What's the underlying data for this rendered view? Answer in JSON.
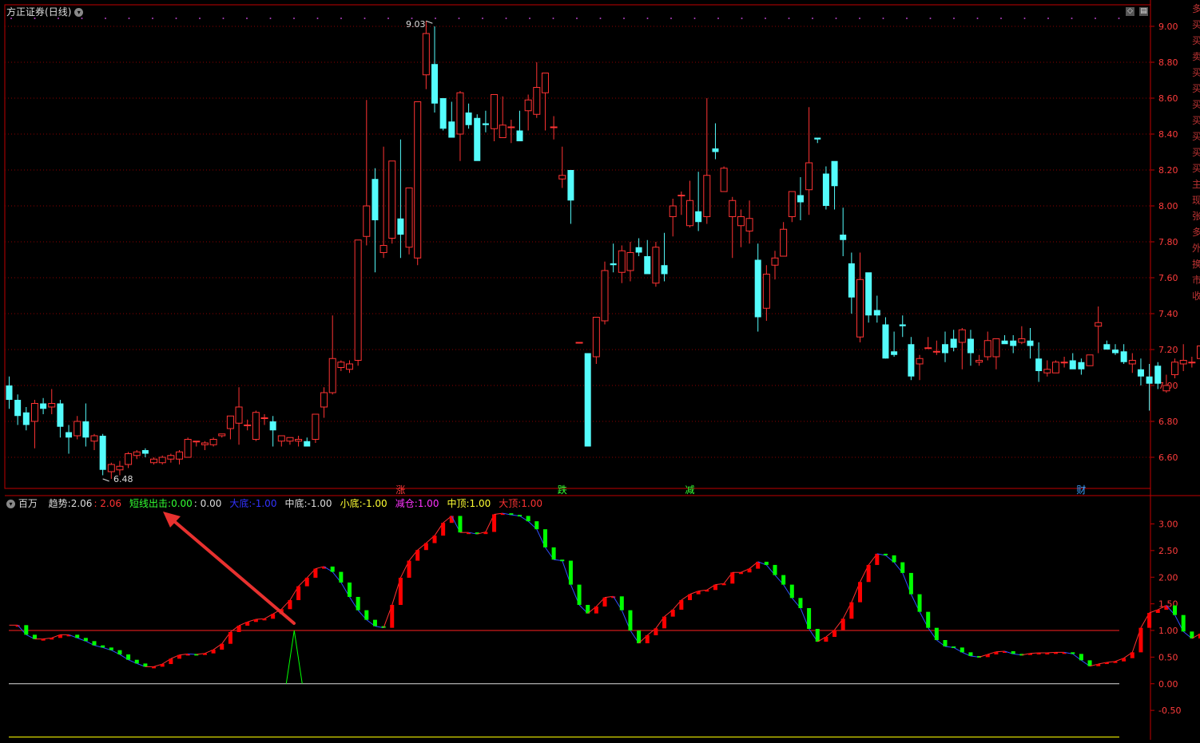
{
  "main_panel": {
    "title": "方正证券",
    "period": "(日线)",
    "high_label": "9.03",
    "low_label": "6.48",
    "event_tags": [
      {
        "text": "涨",
        "color": "#ff3b3b",
        "bar": 46
      },
      {
        "text": "跌",
        "color": "#33ff33",
        "bar": 65
      },
      {
        "text": "减",
        "color": "#33ff33",
        "bar": 80
      },
      {
        "text": "财",
        "color": "#3aa0ff",
        "bar": 126
      }
    ],
    "right_strip": [
      "多",
      "买",
      "买",
      "卖",
      "买",
      "买",
      "买",
      "买",
      "买",
      "买",
      "买",
      "主",
      "现",
      "张",
      "多",
      "外",
      "换",
      "市",
      "收"
    ]
  },
  "indicator_panel": {
    "name": "百万",
    "legend": [
      {
        "label": "趋势:",
        "value": "2.06",
        "color": "#dddddd"
      },
      {
        "label": "",
        "value": ": 2.06",
        "color": "#ff3333"
      },
      {
        "label": "短线出击:",
        "value": "0.00",
        "color": "#33ff33"
      },
      {
        "label": "",
        "value": ": 0.00",
        "color": "#dddddd"
      },
      {
        "label": "大底:",
        "value": "-1.00",
        "color": "#3333ff"
      },
      {
        "label": "中底:",
        "value": "-1.00",
        "color": "#dddddd"
      },
      {
        "label": "小底:",
        "value": "-1.00",
        "color": "#ffff33"
      },
      {
        "label": "减仓:",
        "value": "1.00",
        "color": "#ff33ff"
      },
      {
        "label": "中顶:",
        "value": "1.00",
        "color": "#ffff33"
      },
      {
        "label": "大顶:",
        "value": "1.00",
        "color": "#ff3333"
      }
    ]
  },
  "colors": {
    "up": "#ff3333",
    "down": "#54fcfc",
    "grid": "#8b0000",
    "axis": "#c00000",
    "ind_up": "#ff0000",
    "ind_down": "#00ff00",
    "arrow": "#e8312f"
  },
  "chart_data": [
    {
      "type": "candlestick",
      "title": "方正证券 (日线)",
      "ylim": [
        6.5,
        9.1
      ],
      "y_ticks": [
        "6.60",
        "6.80",
        "7.00",
        "7.20",
        "7.40",
        "7.60",
        "7.80",
        "8.00",
        "8.20",
        "8.40",
        "8.60",
        "8.80",
        "9.00"
      ],
      "ohlc": [
        [
          7.0,
          7.05,
          6.87,
          6.92
        ],
        [
          6.92,
          6.95,
          6.78,
          6.83
        ],
        [
          6.85,
          6.88,
          6.75,
          6.78
        ],
        [
          6.8,
          6.92,
          6.65,
          6.9
        ],
        [
          6.9,
          6.93,
          6.84,
          6.87
        ],
        [
          6.88,
          6.98,
          6.84,
          6.9
        ],
        [
          6.9,
          6.92,
          6.71,
          6.77
        ],
        [
          6.74,
          6.78,
          6.62,
          6.71
        ],
        [
          6.72,
          6.83,
          6.7,
          6.8
        ],
        [
          6.8,
          6.9,
          6.66,
          6.71
        ],
        [
          6.69,
          6.73,
          6.64,
          6.72
        ],
        [
          6.72,
          6.73,
          6.5,
          6.53
        ],
        [
          6.52,
          6.57,
          6.48,
          6.56
        ],
        [
          6.53,
          6.58,
          6.5,
          6.55
        ],
        [
          6.56,
          6.63,
          6.54,
          6.62
        ],
        [
          6.61,
          6.64,
          6.59,
          6.63
        ],
        [
          6.64,
          6.65,
          6.6,
          6.62
        ],
        [
          6.57,
          6.6,
          6.56,
          6.59
        ],
        [
          6.57,
          6.61,
          6.56,
          6.6
        ],
        [
          6.59,
          6.62,
          6.57,
          6.61
        ],
        [
          6.59,
          6.64,
          6.56,
          6.63
        ],
        [
          6.6,
          6.71,
          6.6,
          6.7
        ],
        [
          6.69,
          6.69,
          6.66,
          6.69
        ],
        [
          6.67,
          6.69,
          6.64,
          6.68
        ],
        [
          6.67,
          6.71,
          6.66,
          6.7
        ],
        [
          6.72,
          6.73,
          6.71,
          6.73
        ],
        [
          6.76,
          6.82,
          6.7,
          6.83
        ],
        [
          6.79,
          6.99,
          6.67,
          6.88
        ],
        [
          6.78,
          6.81,
          6.75,
          6.78
        ],
        [
          6.7,
          6.86,
          6.69,
          6.85
        ],
        [
          6.82,
          6.84,
          6.78,
          6.82
        ],
        [
          6.8,
          6.83,
          6.66,
          6.75
        ],
        [
          6.69,
          6.72,
          6.66,
          6.72
        ],
        [
          6.69,
          6.71,
          6.67,
          6.71
        ],
        [
          6.69,
          6.72,
          6.66,
          6.7
        ],
        [
          6.69,
          6.71,
          6.66,
          6.66
        ],
        [
          6.7,
          6.84,
          6.68,
          6.84
        ],
        [
          6.88,
          6.99,
          6.82,
          6.96
        ],
        [
          6.96,
          7.39,
          6.95,
          7.15
        ],
        [
          7.1,
          7.14,
          7.08,
          7.13
        ],
        [
          7.09,
          7.14,
          7.07,
          7.12
        ],
        [
          7.14,
          7.8,
          7.11,
          7.81
        ],
        [
          7.83,
          8.59,
          7.78,
          8.0
        ],
        [
          8.15,
          8.21,
          7.63,
          7.92
        ],
        [
          7.74,
          8.33,
          7.71,
          7.78
        ],
        [
          7.82,
          8.2,
          7.79,
          8.25
        ],
        [
          7.93,
          8.37,
          7.71,
          7.84
        ],
        [
          7.77,
          8.05,
          7.73,
          8.1
        ],
        [
          7.71,
          8.49,
          7.67,
          8.58
        ],
        [
          8.73,
          9.03,
          8.65,
          8.96
        ],
        [
          8.79,
          9.0,
          8.52,
          8.57
        ],
        [
          8.6,
          8.55,
          8.42,
          8.43
        ],
        [
          8.47,
          8.58,
          8.39,
          8.38
        ],
        [
          8.4,
          8.64,
          8.25,
          8.63
        ],
        [
          8.52,
          8.57,
          8.43,
          8.45
        ],
        [
          8.49,
          8.51,
          8.27,
          8.25
        ],
        [
          8.46,
          8.53,
          8.41,
          8.45
        ],
        [
          8.43,
          8.61,
          8.36,
          8.62
        ],
        [
          8.38,
          8.61,
          8.38,
          8.45
        ],
        [
          8.44,
          8.48,
          8.35,
          8.44
        ],
        [
          8.42,
          8.53,
          8.37,
          8.36
        ],
        [
          8.53,
          8.62,
          8.42,
          8.59
        ],
        [
          8.51,
          8.8,
          8.49,
          8.66
        ],
        [
          8.63,
          8.71,
          8.42,
          8.74
        ],
        [
          8.44,
          8.5,
          8.37,
          8.44
        ],
        [
          8.15,
          8.33,
          8.1,
          8.17
        ],
        [
          8.2,
          8.2,
          7.9,
          8.03
        ],
        [
          7.24,
          7.24,
          7.24,
          7.24
        ],
        [
          7.18,
          7.16,
          6.66,
          6.66
        ],
        [
          7.16,
          7.34,
          7.12,
          7.38
        ],
        [
          7.36,
          7.69,
          7.34,
          7.64
        ],
        [
          7.68,
          7.79,
          7.63,
          7.67
        ],
        [
          7.63,
          7.78,
          7.57,
          7.75
        ],
        [
          7.64,
          7.8,
          7.58,
          7.74
        ],
        [
          7.77,
          7.82,
          7.72,
          7.74
        ],
        [
          7.72,
          7.81,
          7.62,
          7.62
        ],
        [
          7.57,
          7.8,
          7.55,
          7.77
        ],
        [
          7.67,
          7.85,
          7.58,
          7.62
        ],
        [
          7.94,
          8.04,
          7.83,
          8.0
        ],
        [
          8.06,
          8.08,
          7.95,
          8.06
        ],
        [
          7.89,
          8.14,
          7.88,
          8.03
        ],
        [
          7.97,
          8.19,
          7.86,
          7.91
        ],
        [
          7.94,
          8.6,
          7.9,
          8.17
        ],
        [
          8.32,
          8.46,
          8.26,
          8.3
        ],
        [
          8.08,
          8.22,
          8.08,
          8.21
        ],
        [
          7.94,
          8.05,
          7.71,
          8.03
        ],
        [
          7.89,
          7.98,
          7.77,
          7.94
        ],
        [
          7.86,
          8.03,
          7.79,
          7.93
        ],
        [
          7.7,
          7.79,
          7.3,
          7.38
        ],
        [
          7.43,
          7.67,
          7.36,
          7.62
        ],
        [
          7.67,
          7.75,
          7.59,
          7.71
        ],
        [
          7.72,
          7.91,
          7.75,
          7.87
        ],
        [
          7.94,
          8.07,
          7.91,
          8.08
        ],
        [
          8.06,
          8.16,
          7.92,
          8.02
        ],
        [
          8.09,
          8.55,
          7.95,
          8.24
        ],
        [
          8.38,
          8.38,
          8.35,
          8.37
        ],
        [
          8.18,
          8.22,
          7.98,
          8.0
        ],
        [
          8.25,
          8.19,
          7.98,
          8.11
        ],
        [
          7.84,
          7.99,
          7.72,
          7.81
        ],
        [
          7.68,
          7.74,
          7.4,
          7.49
        ],
        [
          7.27,
          7.74,
          7.24,
          7.59
        ],
        [
          7.63,
          7.59,
          7.35,
          7.39
        ],
        [
          7.42,
          7.5,
          7.35,
          7.39
        ],
        [
          7.34,
          7.38,
          7.15,
          7.15
        ],
        [
          7.19,
          7.3,
          7.16,
          7.17
        ],
        [
          7.34,
          7.39,
          7.27,
          7.33
        ],
        [
          7.23,
          7.27,
          7.03,
          7.05
        ],
        [
          7.12,
          7.17,
          7.03,
          7.15
        ],
        [
          7.21,
          7.27,
          7.21,
          7.21
        ],
        [
          7.19,
          7.25,
          7.17,
          7.19
        ],
        [
          7.23,
          7.3,
          7.13,
          7.18
        ],
        [
          7.26,
          7.31,
          7.19,
          7.21
        ],
        [
          7.24,
          7.32,
          7.09,
          7.31
        ],
        [
          7.26,
          7.31,
          7.11,
          7.18
        ],
        [
          7.13,
          7.17,
          7.11,
          7.14
        ],
        [
          7.16,
          7.3,
          7.14,
          7.25
        ],
        [
          7.16,
          7.26,
          7.09,
          7.26
        ],
        [
          7.25,
          7.28,
          7.24,
          7.23
        ],
        [
          7.25,
          7.28,
          7.18,
          7.22
        ],
        [
          7.24,
          7.33,
          7.23,
          7.26
        ],
        [
          7.25,
          7.32,
          7.15,
          7.22
        ],
        [
          7.15,
          7.24,
          7.02,
          7.08
        ],
        [
          7.07,
          7.14,
          7.05,
          7.09
        ],
        [
          7.07,
          7.14,
          7.07,
          7.13
        ],
        [
          7.13,
          7.16,
          7.1,
          7.13
        ],
        [
          7.14,
          7.18,
          7.1,
          7.09
        ],
        [
          7.13,
          7.15,
          7.06,
          7.09
        ],
        [
          7.11,
          7.15,
          7.11,
          7.17
        ],
        [
          7.33,
          7.44,
          7.18,
          7.35
        ],
        [
          7.23,
          7.25,
          7.21,
          7.2
        ],
        [
          7.2,
          7.23,
          7.17,
          7.18
        ],
        [
          7.19,
          7.23,
          7.12,
          7.13
        ],
        [
          7.12,
          7.18,
          7.07,
          7.14
        ],
        [
          7.09,
          7.15,
          7.0,
          7.05
        ],
        [
          7.05,
          7.12,
          6.86,
          7.01
        ],
        [
          7.11,
          7.13,
          6.98,
          7.01
        ],
        [
          6.97,
          7.06,
          6.96,
          7.0
        ],
        [
          7.06,
          7.15,
          7.04,
          7.13
        ],
        [
          7.12,
          7.23,
          7.08,
          7.14
        ],
        [
          7.13,
          7.16,
          7.1,
          7.13
        ],
        [
          7.15,
          7.31,
          7.11,
          7.22
        ],
        [
          7.24,
          7.28,
          7.2,
          7.22
        ],
        [
          7.23,
          7.24,
          7.09,
          7.15
        ]
      ]
    },
    {
      "type": "line",
      "title": "百万",
      "ylim": [
        -0.95,
        3.45
      ],
      "y_ticks": [
        "-0.50",
        "0.00",
        "0.50",
        "1.00",
        "1.50",
        "2.00",
        "2.50",
        "3.00"
      ],
      "reference_lines": [
        1.0,
        0.0,
        -1.0
      ],
      "series": [
        {
          "name": "趋势",
          "values": [
            1.1,
            1.1,
            0.92,
            0.84,
            0.84,
            0.86,
            0.92,
            0.92,
            0.86,
            0.8,
            0.72,
            0.68,
            0.63,
            0.55,
            0.45,
            0.38,
            0.32,
            0.32,
            0.37,
            0.47,
            0.54,
            0.56,
            0.55,
            0.57,
            0.64,
            0.75,
            0.97,
            1.09,
            1.16,
            1.21,
            1.22,
            1.31,
            1.4,
            1.57,
            1.83,
            1.99,
            2.16,
            2.2,
            2.1,
            1.9,
            1.63,
            1.38,
            1.2,
            1.08,
            1.05,
            1.48,
            1.99,
            2.31,
            2.51,
            2.64,
            2.78,
            3.02,
            3.15,
            2.84,
            2.84,
            2.81,
            2.85,
            3.18,
            3.2,
            3.17,
            3.15,
            3.05,
            2.9,
            2.56,
            2.33,
            2.31,
            1.86,
            1.48,
            1.32,
            1.45,
            1.62,
            1.64,
            1.38,
            1.0,
            0.76,
            0.91,
            1.04,
            1.26,
            1.39,
            1.57,
            1.68,
            1.74,
            1.76,
            1.86,
            1.88,
            2.09,
            2.09,
            2.16,
            2.29,
            2.23,
            2.04,
            1.86,
            1.61,
            1.42,
            1.03,
            0.79,
            0.88,
            1.01,
            1.22,
            1.53,
            1.91,
            2.23,
            2.44,
            2.41,
            2.28,
            2.08,
            1.68,
            1.35,
            1.05,
            0.82,
            0.7,
            0.68,
            0.59,
            0.52,
            0.5,
            0.55,
            0.6,
            0.61,
            0.56,
            0.54,
            0.57,
            0.58,
            0.58,
            0.59,
            0.59,
            0.56,
            0.44,
            0.33,
            0.37,
            0.4,
            0.42,
            0.48,
            0.59,
            1.05,
            1.33,
            1.39,
            1.47,
            1.29,
            0.98,
            0.85,
            0.94,
            1.12,
            1.39,
            1.63,
            1.86,
            2.04,
            2.06
          ]
        },
        {
          "name": "短线出击",
          "values": []
        }
      ]
    }
  ]
}
